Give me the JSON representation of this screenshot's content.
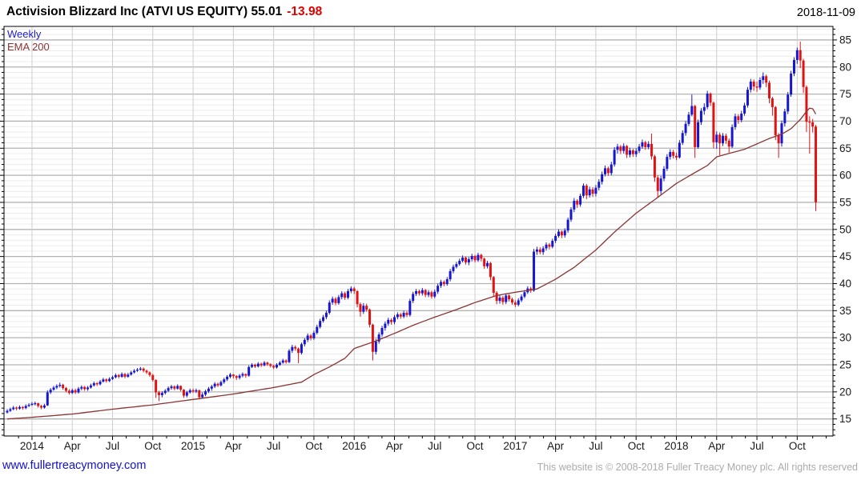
{
  "header": {
    "title": "Activision Blizzard Inc (ATVI US EQUITY) 55.01",
    "change": "-13.98",
    "date": "2018-11-09"
  },
  "legend": {
    "series_label": "Weekly",
    "overlay_label": "EMA 200"
  },
  "footer": {
    "link": "www.fullertreacymoney.com",
    "copyright": "This website is © 2008-2018 Fuller Treacy Money plc. All rights reserved"
  },
  "colors": {
    "up_candle": "#1616d1",
    "down_candle": "#e31212",
    "ema_line": "#8b3434",
    "grid_minor_h": "#ececec",
    "grid_major_h": "#b3b3b3",
    "grid_vertical": "#cdcdcd",
    "frame": "#000000",
    "axis_text": "#1a1a1a",
    "title_text": "#000000",
    "change_text": "#e00000"
  },
  "chart_data": {
    "type": "candlestick",
    "timeframe": "weekly",
    "title": "Activision Blizzard Inc (ATVI US EQUITY)",
    "last_close": 55.01,
    "weekly_change": -13.98,
    "overlay": "EMA 200",
    "grid": "on",
    "legend_position": "top-left-inside",
    "ylim": [
      11.85,
      87.5
    ],
    "y_major_ticks": [
      15,
      20,
      25,
      30,
      35,
      40,
      45,
      50,
      55,
      60,
      65,
      70,
      75,
      80,
      85
    ],
    "y_minor_step": 1,
    "x_ticks": [
      {
        "i": 8,
        "label": "2014"
      },
      {
        "i": 21,
        "label": "Apr"
      },
      {
        "i": 34,
        "label": "Jul"
      },
      {
        "i": 47,
        "label": "Oct"
      },
      {
        "i": 60,
        "label": "2015"
      },
      {
        "i": 73,
        "label": "Apr"
      },
      {
        "i": 86,
        "label": "Jul"
      },
      {
        "i": 99,
        "label": "Oct"
      },
      {
        "i": 112,
        "label": "2016"
      },
      {
        "i": 125,
        "label": "Apr"
      },
      {
        "i": 138,
        "label": "Jul"
      },
      {
        "i": 151,
        "label": "Oct"
      },
      {
        "i": 164,
        "label": "2017"
      },
      {
        "i": 177,
        "label": "Apr"
      },
      {
        "i": 190,
        "label": "Jul"
      },
      {
        "i": 203,
        "label": "Oct"
      },
      {
        "i": 216,
        "label": "2018"
      },
      {
        "i": 229,
        "label": "Apr"
      },
      {
        "i": 242,
        "label": "Jul"
      },
      {
        "i": 255,
        "label": "Oct"
      }
    ],
    "note": "weekly candles Nov-2013..Nov-2018; open of each candle = previous close; first_open applies to candle 0; ema values linearly interpolated between ema_anchors [week_index,value]",
    "first_open": 16.2,
    "candles_hlc": [
      [
        16.8,
        16.0,
        16.5
      ],
      [
        17.1,
        16.3,
        16.8
      ],
      [
        17.4,
        16.6,
        17.1
      ],
      [
        17.3,
        16.6,
        16.9
      ],
      [
        17.5,
        16.7,
        17.2
      ],
      [
        17.4,
        16.7,
        17.0
      ],
      [
        17.7,
        16.8,
        17.4
      ],
      [
        17.9,
        17.2,
        17.6
      ],
      [
        18.1,
        17.4,
        17.8
      ],
      [
        18.2,
        17.5,
        17.9
      ],
      [
        18.0,
        17.1,
        17.4
      ],
      [
        17.6,
        16.8,
        17.1
      ],
      [
        17.8,
        16.9,
        17.5
      ],
      [
        20.3,
        17.4,
        19.9
      ],
      [
        20.7,
        19.6,
        20.4
      ],
      [
        21.1,
        20.2,
        20.8
      ],
      [
        21.4,
        20.5,
        21.1
      ],
      [
        21.7,
        20.8,
        21.3
      ],
      [
        21.5,
        20.4,
        20.7
      ],
      [
        20.9,
        19.9,
        20.2
      ],
      [
        20.5,
        19.5,
        19.8
      ],
      [
        20.6,
        19.6,
        20.3
      ],
      [
        20.6,
        19.6,
        19.9
      ],
      [
        20.9,
        19.7,
        20.6
      ],
      [
        21.2,
        20.3,
        20.9
      ],
      [
        21.1,
        20.2,
        20.5
      ],
      [
        21.1,
        20.2,
        20.8
      ],
      [
        21.5,
        20.6,
        21.2
      ],
      [
        21.9,
        21.0,
        21.6
      ],
      [
        21.8,
        21.1,
        21.4
      ],
      [
        22.2,
        21.2,
        21.9
      ],
      [
        22.6,
        21.7,
        22.3
      ],
      [
        22.5,
        21.7,
        22.0
      ],
      [
        22.7,
        21.8,
        22.4
      ],
      [
        23.0,
        22.2,
        22.7
      ],
      [
        23.4,
        22.5,
        23.1
      ],
      [
        23.3,
        22.5,
        22.8
      ],
      [
        23.6,
        22.6,
        23.3
      ],
      [
        23.5,
        22.5,
        22.8
      ],
      [
        23.5,
        22.6,
        23.2
      ],
      [
        23.9,
        23.0,
        23.6
      ],
      [
        24.2,
        23.4,
        23.9
      ],
      [
        24.4,
        23.7,
        24.1
      ],
      [
        24.6,
        23.9,
        24.3
      ],
      [
        24.5,
        23.6,
        23.9
      ],
      [
        24.1,
        23.3,
        23.6
      ],
      [
        23.8,
        22.8,
        23.1
      ],
      [
        23.3,
        21.9,
        22.2
      ],
      [
        22.3,
        18.9,
        19.9
      ],
      [
        20.2,
        18.3,
        19.4
      ],
      [
        20.1,
        19.0,
        19.8
      ],
      [
        20.5,
        19.5,
        20.2
      ],
      [
        21.0,
        20.0,
        20.7
      ],
      [
        21.3,
        20.4,
        21.0
      ],
      [
        21.2,
        20.3,
        20.6
      ],
      [
        21.4,
        20.4,
        21.1
      ],
      [
        21.2,
        20.1,
        20.4
      ],
      [
        20.5,
        18.9,
        19.3
      ],
      [
        20.2,
        19.0,
        19.9
      ],
      [
        20.6,
        19.7,
        20.3
      ],
      [
        20.6,
        19.8,
        20.1
      ],
      [
        20.6,
        19.8,
        20.3
      ],
      [
        20.4,
        18.6,
        19.0
      ],
      [
        19.9,
        18.8,
        19.5
      ],
      [
        20.4,
        19.2,
        20.1
      ],
      [
        20.9,
        19.8,
        20.6
      ],
      [
        21.3,
        20.2,
        21.0
      ],
      [
        21.8,
        20.7,
        21.5
      ],
      [
        21.7,
        20.9,
        21.2
      ],
      [
        22.1,
        21.0,
        21.8
      ],
      [
        22.6,
        21.5,
        22.3
      ],
      [
        23.1,
        22.0,
        22.8
      ],
      [
        23.5,
        22.5,
        23.2
      ],
      [
        23.3,
        22.5,
        22.9
      ],
      [
        23.1,
        22.2,
        22.6
      ],
      [
        23.3,
        22.3,
        23.0
      ],
      [
        23.6,
        22.7,
        23.3
      ],
      [
        23.4,
        22.6,
        23.0
      ],
      [
        24.9,
        22.8,
        24.6
      ],
      [
        25.3,
        24.4,
        25.0
      ],
      [
        25.2,
        24.4,
        24.7
      ],
      [
        25.5,
        24.5,
        25.2
      ],
      [
        25.4,
        24.6,
        24.9
      ],
      [
        25.7,
        24.7,
        25.4
      ],
      [
        25.6,
        24.8,
        25.1
      ],
      [
        25.3,
        24.5,
        24.8
      ],
      [
        25.0,
        24.2,
        24.5
      ],
      [
        25.3,
        24.3,
        25.0
      ],
      [
        25.7,
        24.8,
        25.4
      ],
      [
        26.1,
        25.2,
        25.8
      ],
      [
        26.0,
        25.2,
        25.5
      ],
      [
        27.9,
        25.3,
        27.6
      ],
      [
        28.7,
        27.2,
        28.3
      ],
      [
        28.6,
        27.6,
        28.0
      ],
      [
        28.2,
        25.3,
        27.2
      ],
      [
        29.1,
        26.9,
        28.8
      ],
      [
        29.9,
        28.4,
        29.6
      ],
      [
        30.8,
        29.2,
        30.4
      ],
      [
        30.7,
        29.5,
        29.9
      ],
      [
        31.3,
        29.6,
        30.9
      ],
      [
        32.4,
        30.6,
        32.0
      ],
      [
        33.5,
        31.7,
        33.1
      ],
      [
        34.2,
        32.8,
        33.8
      ],
      [
        35.0,
        33.4,
        34.6
      ],
      [
        36.9,
        34.3,
        36.5
      ],
      [
        37.6,
        36.1,
        37.2
      ],
      [
        37.5,
        36.0,
        36.4
      ],
      [
        37.9,
        36.1,
        37.5
      ],
      [
        38.6,
        37.1,
        38.2
      ],
      [
        38.5,
        37.0,
        37.4
      ],
      [
        39.0,
        37.1,
        38.6
      ],
      [
        39.5,
        38.2,
        39.1
      ],
      [
        39.4,
        38.1,
        38.6
      ],
      [
        38.8,
        35.6,
        36.2
      ],
      [
        36.5,
        33.9,
        34.8
      ],
      [
        36.4,
        34.4,
        35.9
      ],
      [
        36.3,
        34.8,
        35.2
      ],
      [
        35.4,
        31.9,
        32.4
      ],
      [
        32.6,
        25.8,
        27.4
      ],
      [
        29.8,
        26.9,
        29.3
      ],
      [
        31.0,
        28.9,
        30.6
      ],
      [
        32.2,
        30.2,
        31.8
      ],
      [
        33.0,
        31.3,
        32.6
      ],
      [
        33.7,
        32.2,
        33.3
      ],
      [
        33.6,
        32.4,
        32.9
      ],
      [
        34.2,
        32.5,
        33.8
      ],
      [
        34.7,
        33.4,
        34.3
      ],
      [
        34.6,
        33.5,
        33.9
      ],
      [
        35.0,
        33.6,
        34.6
      ],
      [
        34.9,
        33.8,
        34.2
      ],
      [
        37.2,
        33.9,
        36.8
      ],
      [
        38.5,
        36.4,
        38.1
      ],
      [
        39.0,
        37.7,
        38.6
      ],
      [
        38.9,
        37.8,
        38.2
      ],
      [
        39.2,
        37.8,
        38.8
      ],
      [
        39.0,
        37.5,
        37.9
      ],
      [
        38.8,
        37.5,
        38.4
      ],
      [
        38.7,
        37.2,
        37.6
      ],
      [
        38.9,
        37.3,
        38.5
      ],
      [
        40.0,
        38.1,
        39.6
      ],
      [
        40.7,
        39.2,
        40.3
      ],
      [
        40.6,
        39.5,
        39.9
      ],
      [
        41.2,
        39.6,
        40.8
      ],
      [
        42.7,
        40.4,
        42.3
      ],
      [
        43.5,
        41.9,
        43.1
      ],
      [
        44.0,
        42.8,
        43.6
      ],
      [
        44.6,
        43.3,
        44.2
      ],
      [
        45.2,
        43.9,
        44.8
      ],
      [
        45.0,
        43.5,
        43.9
      ],
      [
        44.9,
        43.4,
        44.5
      ],
      [
        45.5,
        44.1,
        45.1
      ],
      [
        45.3,
        43.9,
        44.3
      ],
      [
        45.7,
        44.0,
        45.3
      ],
      [
        45.5,
        44.1,
        44.6
      ],
      [
        44.8,
        42.7,
        43.2
      ],
      [
        44.2,
        42.8,
        43.8
      ],
      [
        44.0,
        40.6,
        41.2
      ],
      [
        41.4,
        37.6,
        38.3
      ],
      [
        38.6,
        36.2,
        36.8
      ],
      [
        37.8,
        36.3,
        37.4
      ],
      [
        37.7,
        36.1,
        36.6
      ],
      [
        38.2,
        36.2,
        37.8
      ],
      [
        38.0,
        36.7,
        37.1
      ],
      [
        37.4,
        36.1,
        36.5
      ],
      [
        36.9,
        35.7,
        36.1
      ],
      [
        37.3,
        35.8,
        36.9
      ],
      [
        38.0,
        36.6,
        37.6
      ],
      [
        38.8,
        37.3,
        38.4
      ],
      [
        39.5,
        38.1,
        39.1
      ],
      [
        39.4,
        38.3,
        38.7
      ],
      [
        46.4,
        38.5,
        45.9
      ],
      [
        46.8,
        45.3,
        46.3
      ],
      [
        46.7,
        45.4,
        45.8
      ],
      [
        46.9,
        45.3,
        46.5
      ],
      [
        47.6,
        46.1,
        47.2
      ],
      [
        47.5,
        46.3,
        46.8
      ],
      [
        48.3,
        46.5,
        47.9
      ],
      [
        49.2,
        47.5,
        48.8
      ],
      [
        50.0,
        48.5,
        49.6
      ],
      [
        49.8,
        48.4,
        48.9
      ],
      [
        50.2,
        48.5,
        49.8
      ],
      [
        52.2,
        49.4,
        51.8
      ],
      [
        54.1,
        51.4,
        53.7
      ],
      [
        55.8,
        53.2,
        55.3
      ],
      [
        55.6,
        54.0,
        54.6
      ],
      [
        56.6,
        54.2,
        56.2
      ],
      [
        58.5,
        55.8,
        58.1
      ],
      [
        58.4,
        55.6,
        56.3
      ],
      [
        57.9,
        55.9,
        57.4
      ],
      [
        57.8,
        56.0,
        56.6
      ],
      [
        58.2,
        56.1,
        57.7
      ],
      [
        59.3,
        57.2,
        58.8
      ],
      [
        60.7,
        58.3,
        60.2
      ],
      [
        61.8,
        59.8,
        61.3
      ],
      [
        61.6,
        59.9,
        60.4
      ],
      [
        62.5,
        60.0,
        62.0
      ],
      [
        65.2,
        61.6,
        64.7
      ],
      [
        65.8,
        64.0,
        65.3
      ],
      [
        65.6,
        63.9,
        64.5
      ],
      [
        65.9,
        64.0,
        65.4
      ],
      [
        65.6,
        63.2,
        63.8
      ],
      [
        65.1,
        63.3,
        64.6
      ],
      [
        64.9,
        63.4,
        63.9
      ],
      [
        65.0,
        63.4,
        64.5
      ],
      [
        65.8,
        64.1,
        65.3
      ],
      [
        66.6,
        64.9,
        66.1
      ],
      [
        66.4,
        64.7,
        65.2
      ],
      [
        66.3,
        64.8,
        65.8
      ],
      [
        67.7,
        62.9,
        63.5
      ],
      [
        63.8,
        58.8,
        59.6
      ],
      [
        60.0,
        55.9,
        57.1
      ],
      [
        59.9,
        56.5,
        59.4
      ],
      [
        61.7,
        58.9,
        61.2
      ],
      [
        63.9,
        60.8,
        63.4
      ],
      [
        64.8,
        62.9,
        64.3
      ],
      [
        64.7,
        63.1,
        63.6
      ],
      [
        64.2,
        62.8,
        63.3
      ],
      [
        66.5,
        63.1,
        66.0
      ],
      [
        68.3,
        65.6,
        67.8
      ],
      [
        70.0,
        67.3,
        69.5
      ],
      [
        71.7,
        69.1,
        71.2
      ],
      [
        74.9,
        70.9,
        72.8
      ],
      [
        73.0,
        63.2,
        65.2
      ],
      [
        70.3,
        64.9,
        69.8
      ],
      [
        72.4,
        69.3,
        71.9
      ],
      [
        73.3,
        71.2,
        72.6
      ],
      [
        75.6,
        72.2,
        75.1
      ],
      [
        75.3,
        72.8,
        73.4
      ],
      [
        73.6,
        65.0,
        66.1
      ],
      [
        68.1,
        64.9,
        67.5
      ],
      [
        67.9,
        63.7,
        65.9
      ],
      [
        67.8,
        65.4,
        67.3
      ],
      [
        67.7,
        65.8,
        66.4
      ],
      [
        66.8,
        64.2,
        65.3
      ],
      [
        69.4,
        65.0,
        68.9
      ],
      [
        71.4,
        68.4,
        70.9
      ],
      [
        71.3,
        69.5,
        70.2
      ],
      [
        71.9,
        69.8,
        71.4
      ],
      [
        73.4,
        71.0,
        72.9
      ],
      [
        76.3,
        72.5,
        75.8
      ],
      [
        77.8,
        75.3,
        77.3
      ],
      [
        77.7,
        75.6,
        76.4
      ],
      [
        77.3,
        75.4,
        76.2
      ],
      [
        78.1,
        75.8,
        77.6
      ],
      [
        79.0,
        76.9,
        78.3
      ],
      [
        78.6,
        76.3,
        77.1
      ],
      [
        77.5,
        73.3,
        74.2
      ],
      [
        74.5,
        71.0,
        72.6
      ],
      [
        72.8,
        66.5,
        67.4
      ],
      [
        67.8,
        63.2,
        65.9
      ],
      [
        70.1,
        65.3,
        69.6
      ],
      [
        72.3,
        69.0,
        71.8
      ],
      [
        75.4,
        71.3,
        74.9
      ],
      [
        79.3,
        74.5,
        78.8
      ],
      [
        81.8,
        78.3,
        81.3
      ],
      [
        83.6,
        80.6,
        83.1
      ],
      [
        84.7,
        79.8,
        81.2
      ],
      [
        81.5,
        75.2,
        76.3
      ],
      [
        76.6,
        68.0,
        69.9
      ],
      [
        70.9,
        64.0,
        69.8
      ],
      [
        70.4,
        67.9,
        68.99
      ],
      [
        69.3,
        53.4,
        55.01
      ]
    ],
    "ema_anchors": [
      [
        0,
        15.0
      ],
      [
        8,
        15.3
      ],
      [
        21,
        15.9
      ],
      [
        34,
        16.8
      ],
      [
        47,
        17.6
      ],
      [
        60,
        18.6
      ],
      [
        73,
        19.6
      ],
      [
        86,
        20.8
      ],
      [
        95,
        21.8
      ],
      [
        99,
        23.2
      ],
      [
        104,
        24.6
      ],
      [
        109,
        26.2
      ],
      [
        112,
        28.0
      ],
      [
        119,
        29.4
      ],
      [
        125,
        30.8
      ],
      [
        131,
        32.3
      ],
      [
        138,
        33.8
      ],
      [
        145,
        35.2
      ],
      [
        151,
        36.5
      ],
      [
        158,
        37.8
      ],
      [
        164,
        38.4
      ],
      [
        171,
        39.0
      ],
      [
        177,
        40.8
      ],
      [
        183,
        43.0
      ],
      [
        190,
        46.2
      ],
      [
        196,
        49.5
      ],
      [
        203,
        53.0
      ],
      [
        209,
        55.5
      ],
      [
        216,
        58.5
      ],
      [
        222,
        60.5
      ],
      [
        226,
        61.8
      ],
      [
        229,
        63.4
      ],
      [
        234,
        64.2
      ],
      [
        238,
        64.8
      ],
      [
        242,
        65.8
      ],
      [
        246,
        66.8
      ],
      [
        250,
        67.6
      ],
      [
        253,
        68.6
      ],
      [
        256,
        70.3
      ],
      [
        258,
        71.8
      ],
      [
        259,
        72.4
      ],
      [
        260,
        72.3
      ],
      [
        261,
        71.3
      ]
    ]
  }
}
